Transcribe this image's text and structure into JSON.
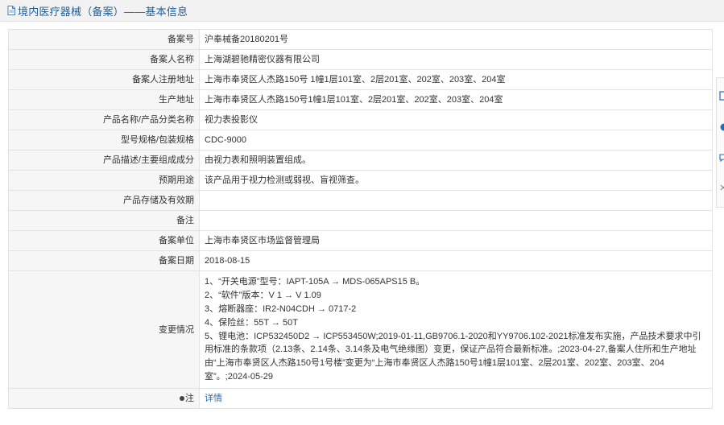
{
  "header": {
    "title": "境内医疗器械（备案）——基本信息"
  },
  "rows": [
    {
      "label": "备案号",
      "value": "沪奉械备20180201号"
    },
    {
      "label": "备案人名称",
      "value": "上海湖碧驰精密仪器有限公司"
    },
    {
      "label": "备案人注册地址",
      "value": "上海市奉贤区人杰路150号 1幢1层101室、2层201室、202室、203室、204室"
    },
    {
      "label": "生产地址",
      "value": "上海市奉贤区人杰路150号1幢1层101室、2层201室、202室、203室、204室"
    },
    {
      "label": "产品名称/产品分类名称",
      "value": "视力表投影仪"
    },
    {
      "label": "型号规格/包装规格",
      "value": "CDC-9000"
    },
    {
      "label": "产品描述/主要组成成分",
      "value": "由视力表和照明装置组成。"
    },
    {
      "label": "预期用途",
      "value": "该产品用于视力检测或弱视、盲视筛查。"
    },
    {
      "label": "产品存储及有效期",
      "value": ""
    },
    {
      "label": "备注",
      "value": ""
    },
    {
      "label": "备案单位",
      "value": "上海市奉贤区市场监督管理局"
    },
    {
      "label": "备案日期",
      "value": "2018-08-15"
    }
  ],
  "changes": {
    "label": "变更情况",
    "lines": [
      "1、“开关电源”型号：IAPT-105A → MDS-065APS15 B。",
      "2、“软件”版本：V 1 → V 1.09",
      "3、熔断器座：IR2-N04CDH → 0717-2",
      "4、保险丝：55T → 50T",
      "5、锂电池：ICP532450D2 → ICP553450W;2019-01-11,GB9706.1-2020和YY9706.102-2021标准发布实施，产品技术要求中引用标准的条款项（2.13条、2.14条、3.14条及电气绝缘图）变更，保证产品符合最新标准。;2023-04-27,备案人住所和生产地址由“上海市奉贤区人杰路150号1号楼”变更为“上海市奉贤区人杰路150号1幢1层101室、2层201室、202室、203室、204室”。;2024-05-29"
    ]
  },
  "note_row": {
    "label": "注",
    "link_text": "详情"
  },
  "icons": {
    "title": "document-icon",
    "note": "pin-icon"
  },
  "colors": {
    "title_text": "#1f5c99",
    "label_bg": "#f6f6f6",
    "link": "#2b6cb0"
  }
}
